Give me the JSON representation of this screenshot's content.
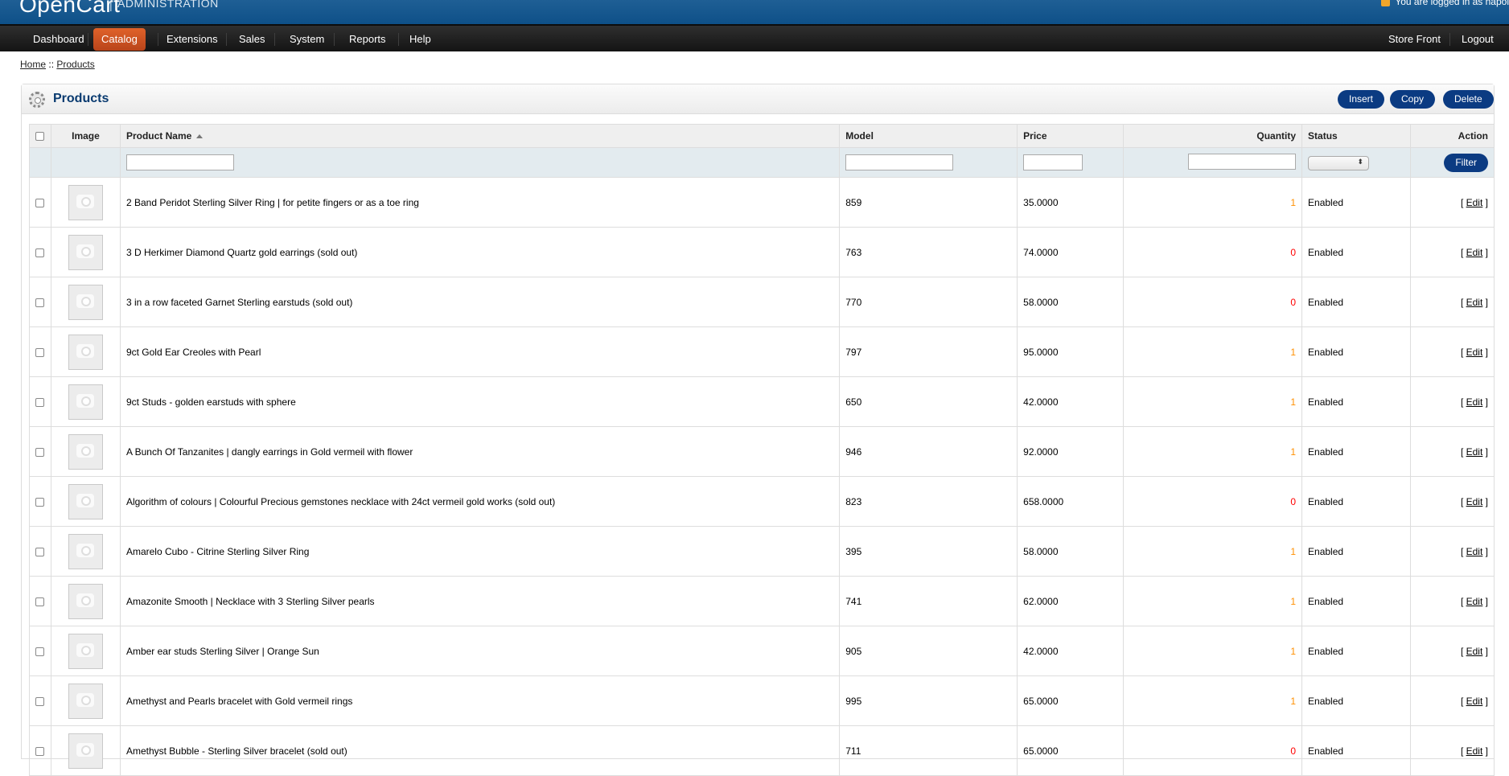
{
  "header": {
    "logo": "OpenCart",
    "subtitle": "ADMINISTRATION",
    "logged_in": "You are logged in as napol"
  },
  "nav": {
    "left": [
      {
        "label": "Dashboard"
      },
      {
        "label": "Catalog",
        "active": true
      },
      {
        "label": "Extensions"
      },
      {
        "label": "Sales"
      },
      {
        "label": "System"
      },
      {
        "label": "Reports"
      },
      {
        "label": "Help"
      }
    ],
    "right": [
      {
        "label": "Store Front"
      },
      {
        "label": "Logout"
      }
    ]
  },
  "breadcrumb": {
    "home": "Home",
    "separator": "::",
    "current": "Products"
  },
  "box": {
    "title": "Products",
    "buttons": {
      "insert": "Insert",
      "copy": "Copy",
      "delete": "Delete"
    }
  },
  "table": {
    "columns": {
      "image": "Image",
      "name": "Product Name",
      "model": "Model",
      "price": "Price",
      "quantity": "Quantity",
      "status": "Status",
      "action": "Action"
    },
    "filter_button": "Filter",
    "edit_open": "[",
    "edit_label": "Edit",
    "edit_close": "]",
    "rows": [
      {
        "name": "2 Band Peridot Sterling Silver Ring | for petite fingers or as a toe ring",
        "model": "859",
        "price": "35.0000",
        "quantity": "1",
        "status": "Enabled"
      },
      {
        "name": "3 D Herkimer Diamond Quartz gold earrings (sold out)",
        "model": "763",
        "price": "74.0000",
        "quantity": "0",
        "status": "Enabled"
      },
      {
        "name": "3 in a row faceted Garnet Sterling earstuds (sold out)",
        "model": "770",
        "price": "58.0000",
        "quantity": "0",
        "status": "Enabled"
      },
      {
        "name": "9ct Gold Ear Creoles with Pearl",
        "model": "797",
        "price": "95.0000",
        "quantity": "1",
        "status": "Enabled"
      },
      {
        "name": "9ct Studs - golden earstuds with sphere",
        "model": "650",
        "price": "42.0000",
        "quantity": "1",
        "status": "Enabled"
      },
      {
        "name": "A Bunch Of Tanzanites | dangly earrings in Gold vermeil with flower",
        "model": "946",
        "price": "92.0000",
        "quantity": "1",
        "status": "Enabled"
      },
      {
        "name": "Algorithm of colours | Colourful Precious gemstones necklace with 24ct vermeil gold works (sold out)",
        "model": "823",
        "price": "658.0000",
        "quantity": "0",
        "status": "Enabled"
      },
      {
        "name": "Amarelo Cubo - Citrine Sterling Silver Ring",
        "model": "395",
        "price": "58.0000",
        "quantity": "1",
        "status": "Enabled"
      },
      {
        "name": "Amazonite Smooth | Necklace with 3 Sterling Silver pearls",
        "model": "741",
        "price": "62.0000",
        "quantity": "1",
        "status": "Enabled"
      },
      {
        "name": "Amber ear studs Sterling Silver | Orange Sun",
        "model": "905",
        "price": "42.0000",
        "quantity": "1",
        "status": "Enabled"
      },
      {
        "name": "Amethyst and Pearls bracelet with Gold vermeil rings",
        "model": "995",
        "price": "65.0000",
        "quantity": "1",
        "status": "Enabled"
      },
      {
        "name": "Amethyst Bubble - Sterling Silver bracelet (sold out)",
        "model": "711",
        "price": "65.0000",
        "quantity": "0",
        "status": "Enabled"
      }
    ]
  },
  "colors": {
    "header_blue": "#11548c",
    "nav_active": "#d2552a",
    "title_blue": "#0a3b70",
    "button_blue": "#0b3b82",
    "qty_in_stock": "#ff8f00",
    "qty_out_of_stock": "#ff0000"
  }
}
